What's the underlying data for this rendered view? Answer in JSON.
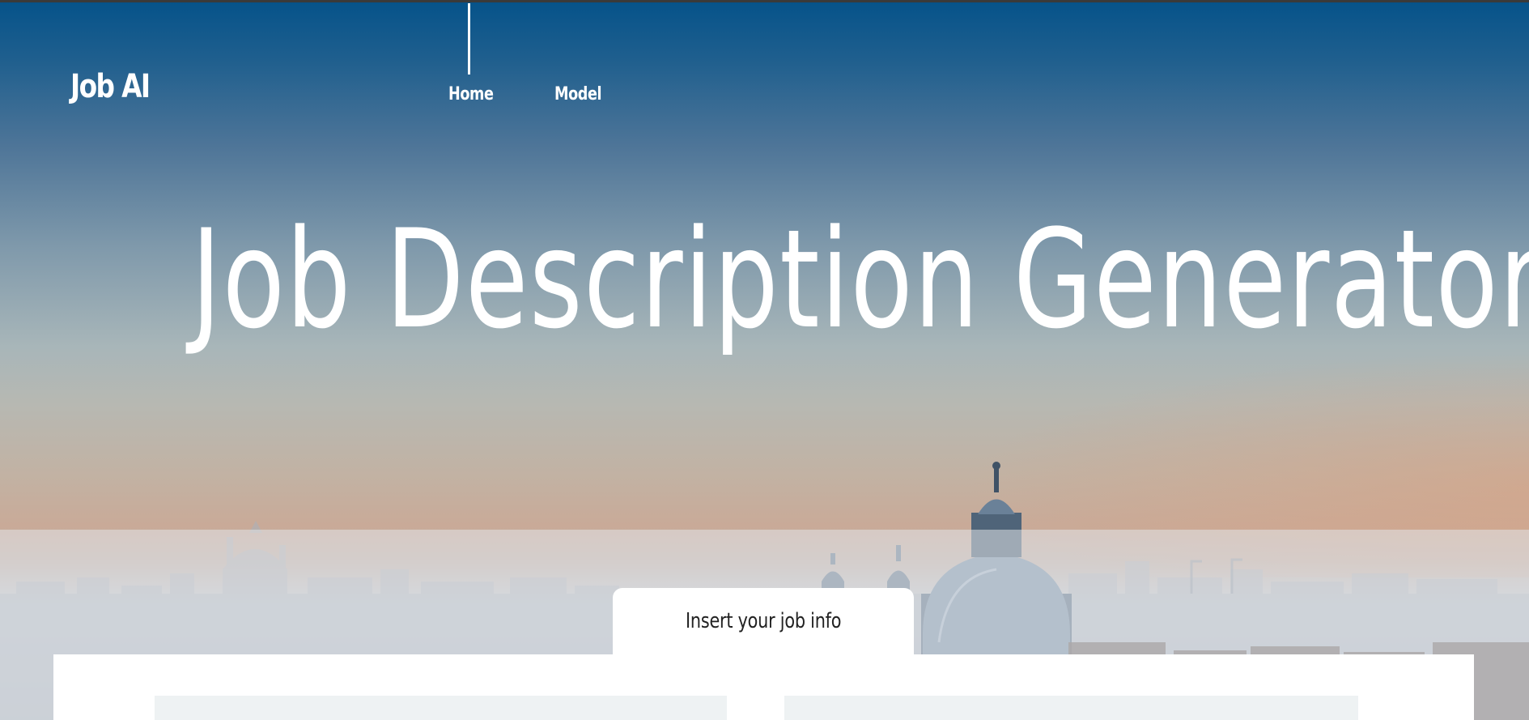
{
  "brand": {
    "name": "Job AI"
  },
  "nav": {
    "items": [
      {
        "label": "Home",
        "active": true
      },
      {
        "label": "Model",
        "active": false
      }
    ]
  },
  "hero": {
    "title": "Job Description Generator"
  },
  "form": {
    "tab_label": "Insert your job info",
    "fields": [
      {
        "value": "",
        "placeholder": ""
      },
      {
        "value": "",
        "placeholder": ""
      }
    ]
  },
  "colors": {
    "sky_top": "#06538a",
    "panel_bg": "#ffffff",
    "field_bg": "#eef2f3",
    "text_light": "#ffffff",
    "text_dark": "#222222"
  }
}
